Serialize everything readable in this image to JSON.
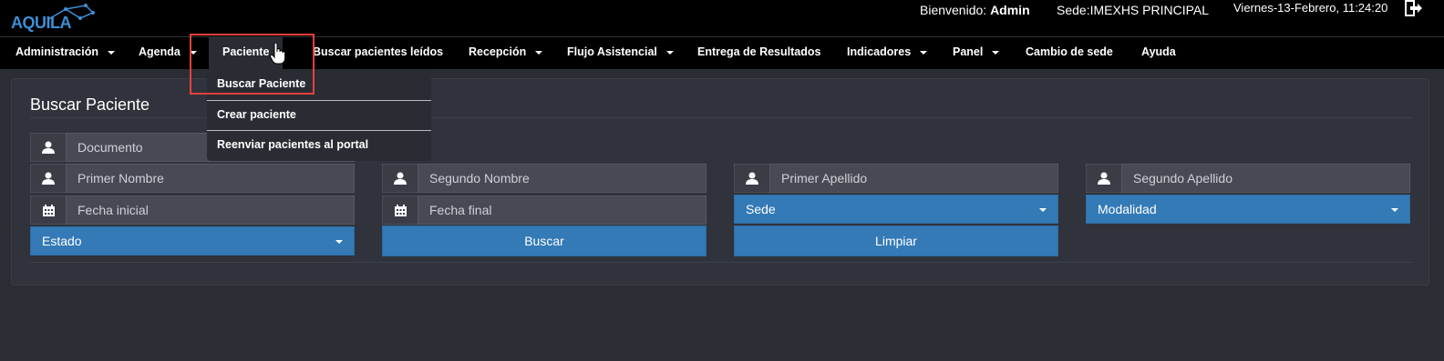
{
  "app": {
    "logo_text": "AQUILA"
  },
  "header": {
    "welcome_label": "Bienvenido:",
    "user": "Admin",
    "sede": "Sede:IMEXHS PRINCIPAL",
    "datetime": "Viernes-13-Febrero, 11:24:20"
  },
  "nav": {
    "items": [
      {
        "label": "Administración",
        "caret": true
      },
      {
        "label": "Agenda",
        "caret": true
      },
      {
        "label": "Paciente",
        "caret": false
      },
      {
        "label": "Buscar pacientes leídos",
        "caret": false
      },
      {
        "label": "Recepción",
        "caret": true
      },
      {
        "label": "Flujo Asistencial",
        "caret": true
      },
      {
        "label": "Entrega de Resultados",
        "caret": false
      },
      {
        "label": "Indicadores",
        "caret": true
      },
      {
        "label": "Panel",
        "caret": true
      },
      {
        "label": "Cambio de sede",
        "caret": false
      },
      {
        "label": "Ayuda",
        "caret": false
      }
    ],
    "dropdown": [
      {
        "label": "Buscar Paciente"
      },
      {
        "label": "Crear paciente"
      },
      {
        "label": "Reenviar pacientes al portal"
      }
    ]
  },
  "search": {
    "title": "Buscar Paciente",
    "documento": "Documento",
    "primer_nombre": "Primer Nombre",
    "segundo_nombre": "Segundo Nombre",
    "primer_apellido": "Primer Apellido",
    "segundo_apellido": "Segundo Apellido",
    "fecha_inicial": "Fecha inicial",
    "fecha_final": "Fecha final",
    "sede_select": "Sede",
    "modalidad_select": "Modalidad",
    "estado_select": "Estado",
    "buscar_button": "Buscar",
    "limpiar_button": "Limpiar"
  },
  "colors": {
    "accent": "#337ab7",
    "highlight": "#e8403d",
    "logo": "#3d8fd6"
  }
}
